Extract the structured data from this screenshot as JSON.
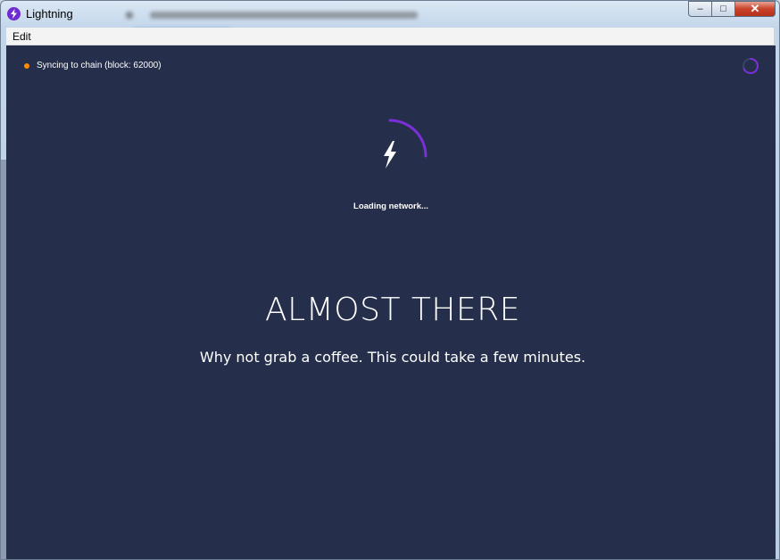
{
  "window": {
    "title": "Lightning",
    "controls": {
      "minimize": "–",
      "maximize": "□",
      "close": "✕"
    }
  },
  "menu": {
    "items": [
      {
        "label": "Edit"
      }
    ]
  },
  "status": {
    "text": "Syncing to chain (block: 62000)",
    "dot_color": "#ff8a00"
  },
  "loading": {
    "text": "Loading network...",
    "icon": "lightning-bolt-icon"
  },
  "headline": "ALMOST THERE",
  "subline": "Why not grab a coffee. This could take a few minutes.",
  "colors": {
    "background": "#252f4b",
    "accent": "#7b2fd8",
    "text": "#ffffff"
  }
}
